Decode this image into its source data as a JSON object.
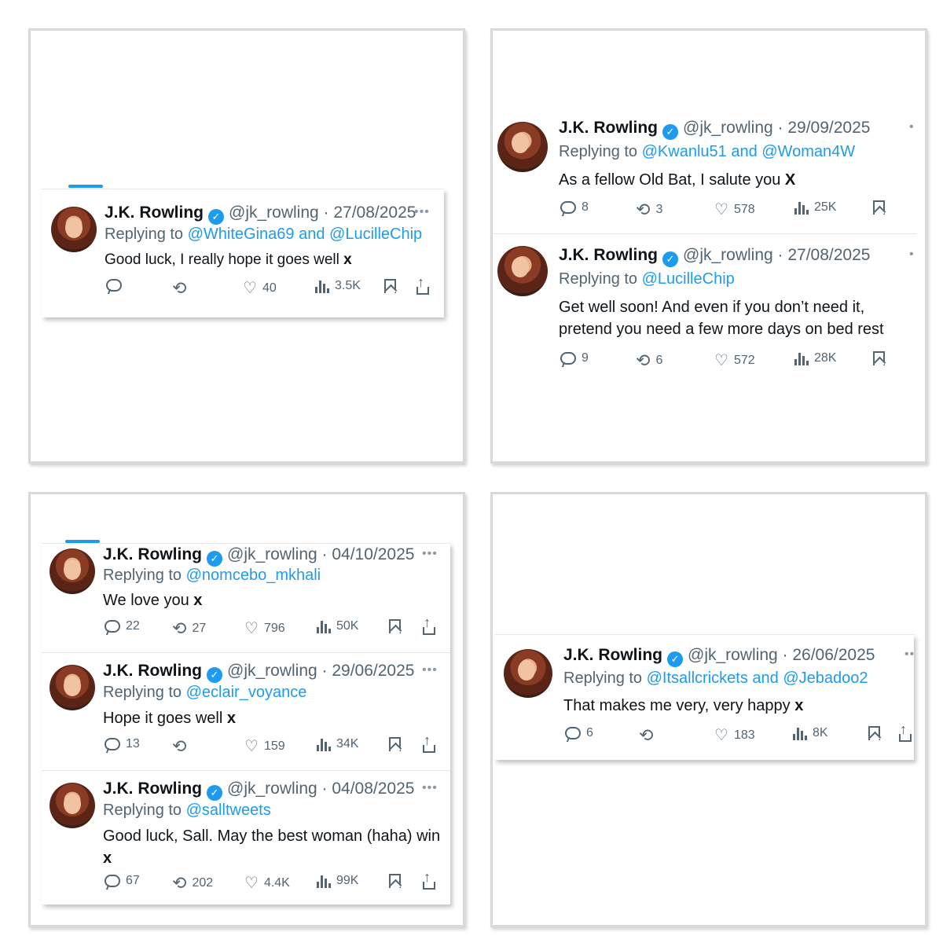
{
  "tweets": {
    "t1": {
      "name": "J.K. Rowling",
      "handle_date": "@jk_rowling · 27/08/2025",
      "reply_prefix": "Replying to ",
      "reply_to": "@WhiteGina69 and @LucilleChip",
      "text": "Good luck, I really hope it goes well ",
      "text_end": "x",
      "replies": "",
      "retweets": "",
      "likes": "40",
      "views": "3.5K"
    },
    "t2": {
      "name": "J.K. Rowling",
      "handle_date": "@jk_rowling · 29/09/2025",
      "reply_prefix": "Replying to ",
      "reply_to": "@Kwanlu51 and @Woman4W",
      "text": "As a fellow Old Bat, I salute you ",
      "text_end": "X",
      "replies": "8",
      "retweets": "3",
      "likes": "578",
      "views": "25K"
    },
    "t3": {
      "name": "J.K. Rowling",
      "handle_date": "@jk_rowling · 27/08/2025",
      "reply_prefix": "Replying to ",
      "reply_to": "@LucilleChip",
      "text_line1": "Get well soon! And even if you don’t need it,",
      "text_line2": "pretend you need a few more days on bed rest",
      "replies": "9",
      "retweets": "6",
      "likes": "572",
      "views": "28K"
    },
    "t4": {
      "name": "J.K. Rowling",
      "handle_date": "@jk_rowling · 04/10/2025",
      "reply_prefix": "Replying to ",
      "reply_to": "@nomcebo_mkhali",
      "text": "We love you ",
      "text_end": "x",
      "replies": "22",
      "retweets": "27",
      "likes": "796",
      "views": "50K"
    },
    "t5": {
      "name": "J.K. Rowling",
      "handle_date": "@jk_rowling · 29/06/2025",
      "reply_prefix": "Replying to ",
      "reply_to": "@eclair_voyance",
      "text": "Hope it goes well ",
      "text_end": "x",
      "replies": "13",
      "retweets": "",
      "likes": "159",
      "views": "34K"
    },
    "t6": {
      "name": "J.K. Rowling",
      "handle_date": "@jk_rowling · 04/08/2025",
      "reply_prefix": "Replying to ",
      "reply_to": "@salltweets",
      "text": "Good luck, Sall. May the best woman (haha) win",
      "text_end": "x",
      "replies": "67",
      "retweets": "202",
      "likes": "4.4K",
      "views": "99K"
    },
    "t7": {
      "name": "J.K. Rowling",
      "handle_date": "@jk_rowling · 26/06/2025",
      "reply_prefix": "Replying to ",
      "reply_to": "@Itsallcrickets and @Jebadoo2",
      "text": "That makes me very, very happy ",
      "text_end": "x",
      "replies": "6",
      "retweets": "",
      "likes": "183",
      "views": "8K"
    }
  },
  "verified_glyph": "✓",
  "more_glyph": "•••",
  "colors": {
    "link": "#1d9bf0",
    "muted": "#536471",
    "verified": "#1d9bf0"
  },
  "icons": [
    "reply-icon",
    "retweet-icon",
    "like-icon",
    "views-icon",
    "bookmark-icon",
    "share-icon",
    "verified-badge-icon",
    "more-options-icon"
  ]
}
